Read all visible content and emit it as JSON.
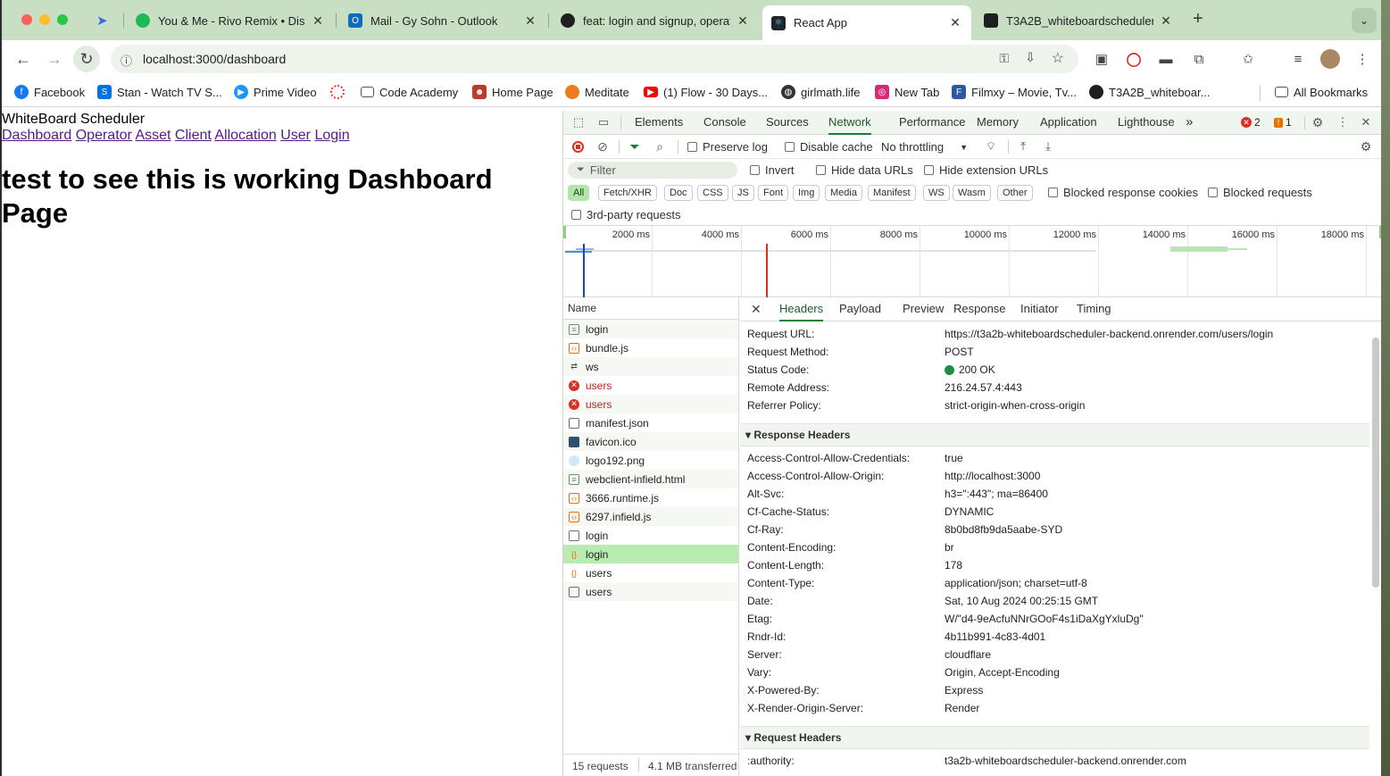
{
  "tabs": [
    {
      "title": "You & Me - Rivo Remix • Disc",
      "icon": "spotify-icon",
      "color": "#1db954"
    },
    {
      "title": "Mail - Gy Sohn - Outlook",
      "icon": "outlook-icon",
      "color": "#0f6cbd"
    },
    {
      "title": "feat: login and signup, operat",
      "icon": "github-icon",
      "color": "#1f1f1f"
    },
    {
      "title": "React App",
      "icon": "react-icon",
      "color": "#149eca",
      "active": true
    },
    {
      "title": "T3A2B_whiteboardscheduler",
      "icon": "render-icon",
      "color": "#1f1f1f"
    }
  ],
  "toolbar": {
    "url": "localhost:3000/dashboard"
  },
  "bookmarks": [
    {
      "label": "Facebook",
      "color": "#1877f2",
      "icon": "facebook-icon"
    },
    {
      "label": "Stan - Watch TV S...",
      "color": "#0072e8",
      "icon": "stan-icon"
    },
    {
      "label": "Prime Video",
      "color": "#1a98ff",
      "icon": "prime-video-icon"
    },
    {
      "label": "",
      "color": "#e23b2e",
      "icon": "ring-icon"
    },
    {
      "label": "Code Academy",
      "color": "#555555",
      "icon": "folder-icon"
    },
    {
      "label": "Home Page",
      "color": "#c0392b",
      "icon": "person-icon"
    },
    {
      "label": "Meditate",
      "color": "#f07b1f",
      "icon": "meditate-icon"
    },
    {
      "label": "(1) Flow - 30 Days...",
      "color": "#ff0000",
      "icon": "youtube-icon"
    },
    {
      "label": "girlmath.life",
      "color": "#333333",
      "icon": "globe-icon"
    },
    {
      "label": "New Tab",
      "color": "#d62976",
      "icon": "instagram-icon"
    },
    {
      "label": "Filmxy – Movie, Tv...",
      "color": "#2c5aa0",
      "icon": "filmxy-icon"
    },
    {
      "label": "T3A2B_whiteboar...",
      "color": "#1f1f1f",
      "icon": "github-icon"
    },
    {
      "label": "All Bookmarks",
      "color": "#555555",
      "icon": "folder-icon"
    }
  ],
  "page": {
    "app_title": "WhiteBoard Scheduler",
    "links": [
      "Dashboard",
      "Operator",
      "Asset",
      "Client",
      "Allocation",
      "User",
      "Login"
    ],
    "heading": "test to see this is working Dashboard Page"
  },
  "devtools": {
    "tabs": [
      "Elements",
      "Console",
      "Sources",
      "Network",
      "Performance",
      "Memory",
      "Application",
      "Lighthouse"
    ],
    "active_tab": "Network",
    "more": "»",
    "errors": "2",
    "warnings": "1",
    "preserve_log": "Preserve log",
    "disable_cache": "Disable cache",
    "throttling": "No throttling",
    "filter_placeholder": "Filter",
    "invert": "Invert",
    "hide_data_urls": "Hide data URLs",
    "hide_extension_urls": "Hide extension URLs",
    "type_filters": [
      "All",
      "Fetch/XHR",
      "Doc",
      "CSS",
      "JS",
      "Font",
      "Img",
      "Media",
      "Manifest",
      "WS",
      "Wasm",
      "Other"
    ],
    "blocked_response_cookies": "Blocked response cookies",
    "blocked_requests": "Blocked requests",
    "third_party": "3rd-party requests",
    "timeline_ticks": [
      "2000 ms",
      "4000 ms",
      "6000 ms",
      "8000 ms",
      "10000 ms",
      "12000 ms",
      "14000 ms",
      "16000 ms",
      "18000 ms"
    ],
    "name_header": "Name",
    "requests": [
      {
        "name": "login",
        "type": "doc"
      },
      {
        "name": "bundle.js",
        "type": "script"
      },
      {
        "name": "ws",
        "type": "ws"
      },
      {
        "name": "users",
        "type": "error"
      },
      {
        "name": "users",
        "type": "error"
      },
      {
        "name": "manifest.json",
        "type": "manifest"
      },
      {
        "name": "favicon.ico",
        "type": "image"
      },
      {
        "name": "logo192.png",
        "type": "image-light"
      },
      {
        "name": "webclient-infield.html",
        "type": "doc"
      },
      {
        "name": "3666.runtime.js",
        "type": "script"
      },
      {
        "name": "6297.infield.js",
        "type": "script"
      },
      {
        "name": "login",
        "type": "blank"
      },
      {
        "name": "login",
        "type": "fetch",
        "selected": true
      },
      {
        "name": "users",
        "type": "fetch"
      },
      {
        "name": "users",
        "type": "blank"
      }
    ],
    "summary_requests": "15 requests",
    "summary_transferred": "4.1 MB transferred",
    "detail_tabs": [
      "Headers",
      "Payload",
      "Preview",
      "Response",
      "Initiator",
      "Timing"
    ],
    "general": [
      {
        "k": "Request URL:",
        "v": "https://t3a2b-whiteboardscheduler-backend.onrender.com/users/login"
      },
      {
        "k": "Request Method:",
        "v": "POST"
      },
      {
        "k": "Status Code:",
        "v": "200 OK"
      },
      {
        "k": "Remote Address:",
        "v": "216.24.57.4:443"
      },
      {
        "k": "Referrer Policy:",
        "v": "strict-origin-when-cross-origin"
      }
    ],
    "response_headers_title": "▾ Response Headers",
    "response_headers": [
      {
        "k": "Access-Control-Allow-Credentials:",
        "v": "true"
      },
      {
        "k": "Access-Control-Allow-Origin:",
        "v": "http://localhost:3000"
      },
      {
        "k": "Alt-Svc:",
        "v": "h3=\":443\"; ma=86400"
      },
      {
        "k": "Cf-Cache-Status:",
        "v": "DYNAMIC"
      },
      {
        "k": "Cf-Ray:",
        "v": "8b0bd8fb9da5aabe-SYD"
      },
      {
        "k": "Content-Encoding:",
        "v": "br"
      },
      {
        "k": "Content-Length:",
        "v": "178"
      },
      {
        "k": "Content-Type:",
        "v": "application/json; charset=utf-8"
      },
      {
        "k": "Date:",
        "v": "Sat, 10 Aug 2024 00:25:15 GMT"
      },
      {
        "k": "Etag:",
        "v": "W/\"d4-9eAcfuNNrGOoF4s1iDaXgYxluDg\""
      },
      {
        "k": "Rndr-Id:",
        "v": "4b11b991-4c83-4d01"
      },
      {
        "k": "Server:",
        "v": "cloudflare"
      },
      {
        "k": "Vary:",
        "v": "Origin, Accept-Encoding"
      },
      {
        "k": "X-Powered-By:",
        "v": "Express"
      },
      {
        "k": "X-Render-Origin-Server:",
        "v": "Render"
      }
    ],
    "request_headers_title": "▾ Request Headers",
    "request_headers": [
      {
        "k": ":authority:",
        "v": "t3a2b-whiteboardscheduler-backend.onrender.com"
      }
    ]
  }
}
